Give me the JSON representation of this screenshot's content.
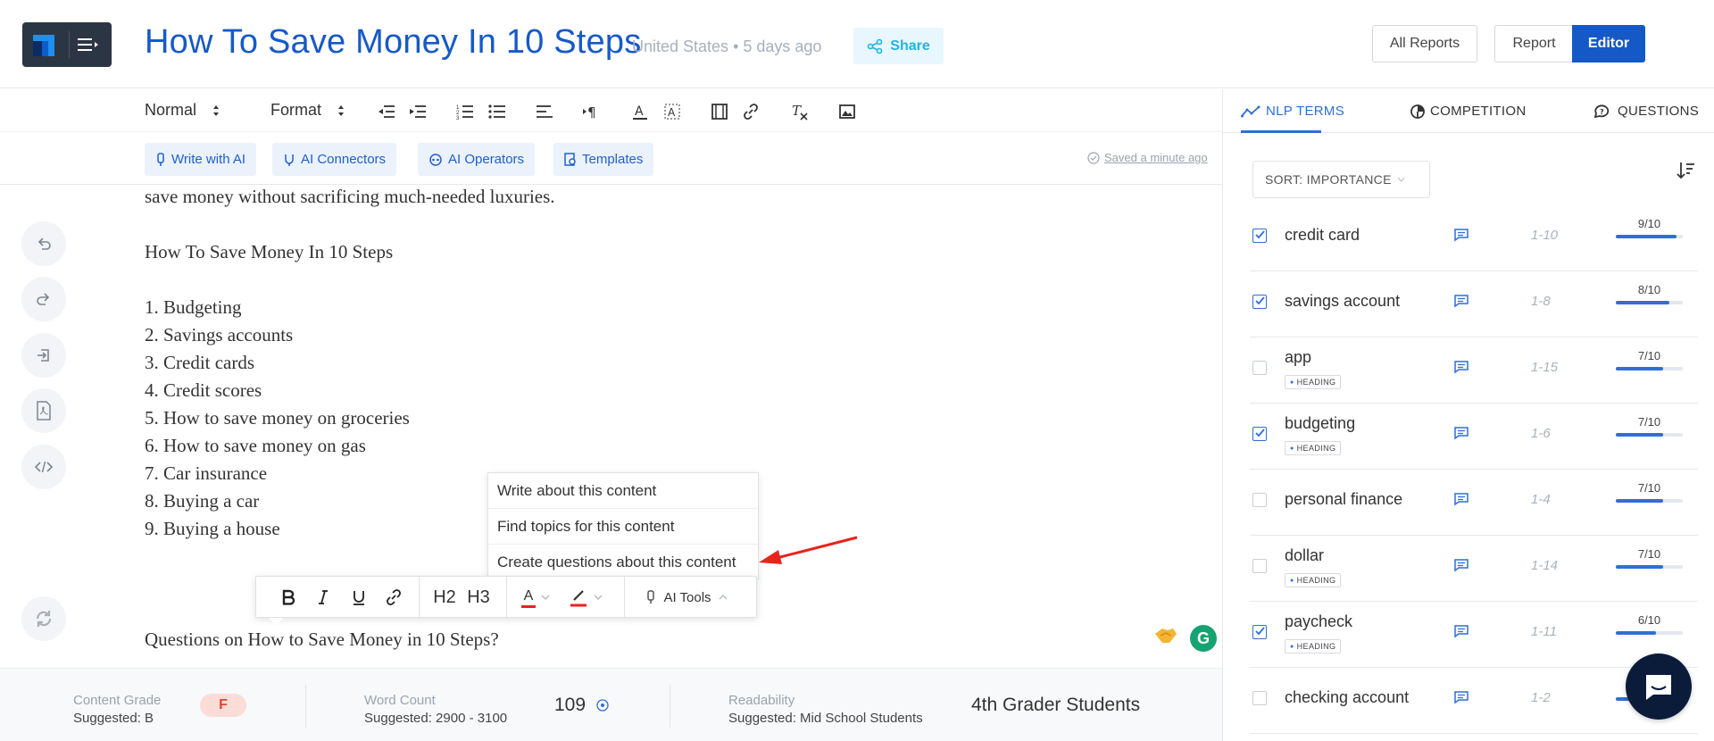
{
  "header": {
    "title": "How To Save Money In 10 Steps",
    "meta": "United States • 5 days ago",
    "share_label": "Share",
    "all_reports_label": "All Reports",
    "report_label": "Report",
    "editor_label": "Editor"
  },
  "toolbar": {
    "style_select": "Normal",
    "format_select": "Format",
    "write_ai": "Write with AI",
    "ai_connectors": "AI Connectors",
    "ai_operators": "AI Operators",
    "templates": "Templates",
    "saved_status": "Saved a minute ago"
  },
  "editor": {
    "lines": [
      "save money without sacrificing much-needed luxuries.",
      "How To Save Money In 10 Steps",
      " 1. Budgeting",
      "2. Savings accounts",
      "3. Credit cards",
      "4. Credit scores",
      "5. How to save money on groceries",
      "6. How to save money on gas",
      "7. Car insurance",
      "8. Buying a car",
      "9. Buying a house",
      "Questions on How to Save Money in 10 Steps?"
    ]
  },
  "ai_menu": {
    "items": [
      "Write about this content",
      "Find topics for this content",
      "Create questions about this content"
    ]
  },
  "format_bar": {
    "h2": "H2",
    "h3": "H3",
    "text_color": "A",
    "ai_tools": "AI Tools"
  },
  "stats": {
    "content_grade_label": "Content Grade",
    "content_grade_suggested": "Suggested: B",
    "content_grade_value": "F",
    "word_count_label": "Word Count",
    "word_count_suggested": "Suggested: 2900 - 3100",
    "word_count_value": "109",
    "readability_label": "Readability",
    "readability_suggested": "Suggested: Mid School Students",
    "readability_value": "4th Grader Students"
  },
  "panel": {
    "tabs": [
      "NLP TERMS",
      "COMPETITION",
      "QUESTIONS"
    ],
    "sort_label": "SORT: IMPORTANCE",
    "heading_tag": "HEADING",
    "terms": [
      {
        "name": "credit card",
        "checked": true,
        "heading": false,
        "range": "1-10",
        "score": "9/10",
        "fill": 0.9
      },
      {
        "name": "savings account",
        "checked": true,
        "heading": false,
        "range": "1-8",
        "score": "8/10",
        "fill": 0.8
      },
      {
        "name": "app",
        "checked": false,
        "heading": true,
        "range": "1-15",
        "score": "7/10",
        "fill": 0.7
      },
      {
        "name": "budgeting",
        "checked": true,
        "heading": true,
        "range": "1-6",
        "score": "7/10",
        "fill": 0.7
      },
      {
        "name": "personal finance",
        "checked": false,
        "heading": false,
        "range": "1-4",
        "score": "7/10",
        "fill": 0.7
      },
      {
        "name": "dollar",
        "checked": false,
        "heading": true,
        "range": "1-14",
        "score": "7/10",
        "fill": 0.7
      },
      {
        "name": "paycheck",
        "checked": true,
        "heading": true,
        "range": "1-11",
        "score": "6/10",
        "fill": 0.6
      },
      {
        "name": "checking account",
        "checked": false,
        "heading": false,
        "range": "1-2",
        "score": "",
        "fill": 0.6
      }
    ]
  },
  "colors": {
    "brand": "#1559c7",
    "accent": "#2f6fd6",
    "grade_bad": "#e0452b"
  }
}
